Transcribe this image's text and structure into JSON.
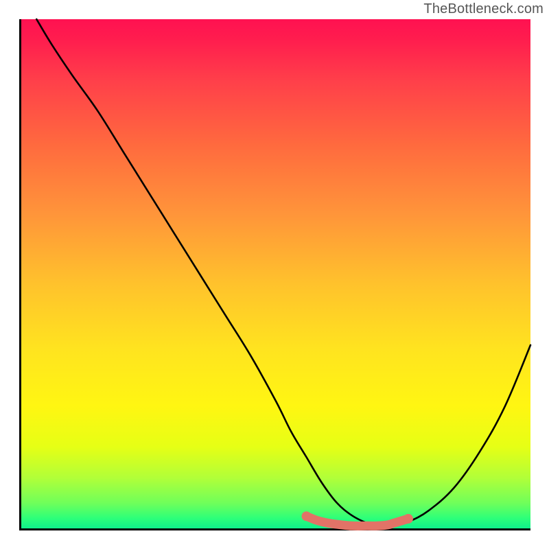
{
  "attribution": "TheBottleneck.com",
  "chart_data": {
    "type": "line",
    "title": "",
    "xlabel": "",
    "ylabel": "",
    "xlim": [
      0,
      100
    ],
    "ylim": [
      0,
      100
    ],
    "grid": false,
    "legend": false,
    "background_gradient": {
      "direction": "vertical",
      "stops": [
        {
          "pos": 0,
          "color": "#ff1151"
        },
        {
          "pos": 50,
          "color": "#ffd21f"
        },
        {
          "pos": 100,
          "color": "#0ff08b"
        }
      ]
    },
    "series": [
      {
        "name": "bottleneck-curve",
        "color": "#000000",
        "stroke_width": 2,
        "x": [
          3,
          6,
          10,
          15,
          20,
          25,
          30,
          35,
          40,
          45,
          50,
          53,
          56,
          59,
          62,
          65,
          68,
          70,
          73,
          76,
          80,
          85,
          90,
          95,
          100
        ],
        "values": [
          100,
          95,
          89,
          82,
          74,
          66,
          58,
          50,
          42,
          34,
          25,
          19,
          14,
          9,
          5,
          2.5,
          1,
          0.5,
          0.5,
          1.3,
          3.5,
          8,
          15,
          24,
          36
        ]
      },
      {
        "name": "highlight-band",
        "color": "#e27367",
        "stroke_width": 10,
        "x": [
          56,
          58,
          60,
          62,
          65,
          68,
          70,
          72,
          73,
          74,
          76
        ],
        "values": [
          2.4,
          1.6,
          1.1,
          0.8,
          0.5,
          0.5,
          0.5,
          0.7,
          1,
          1.3,
          1.9
        ]
      }
    ],
    "highlight_endpoints": [
      {
        "x": 56,
        "y": 2.4,
        "r": 7,
        "color": "#e27367"
      },
      {
        "x": 76,
        "y": 1.9,
        "r": 7,
        "color": "#e27367"
      }
    ]
  }
}
